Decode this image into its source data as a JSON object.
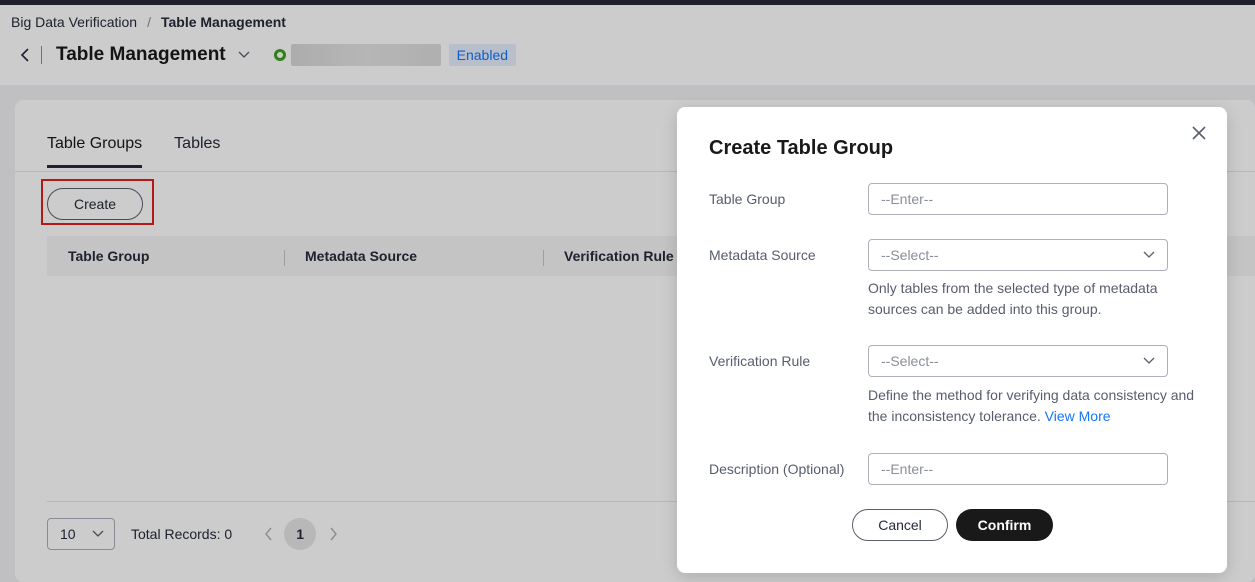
{
  "breadcrumb": {
    "parent": "Big Data Verification",
    "separator": "/",
    "current": "Table Management"
  },
  "header": {
    "title": "Table Management",
    "status": "Enabled"
  },
  "tabs": [
    {
      "label": "Table Groups",
      "active": true
    },
    {
      "label": "Tables",
      "active": false
    }
  ],
  "toolbar": {
    "create_label": "Create"
  },
  "table": {
    "columns": [
      "Table Group",
      "Metadata Source",
      "Verification Rule"
    ]
  },
  "pagination": {
    "page_size": "10",
    "total": "Total Records: 0",
    "current_page": "1"
  },
  "modal": {
    "title": "Create Table Group",
    "fields": {
      "table_group": {
        "label": "Table Group",
        "placeholder": "--Enter--"
      },
      "metadata_source": {
        "label": "Metadata Source",
        "placeholder": "--Select--",
        "help_line1": "Only tables from the selected type of metadata",
        "help_line2": "sources can be added into this group."
      },
      "verification_rule": {
        "label": "Verification Rule",
        "placeholder": "--Select--",
        "help_line1": "Define the method for verifying data consistency and",
        "help_line2": "the inconsistency tolerance.",
        "help_link": "View More"
      },
      "description": {
        "label": "Description (Optional)",
        "placeholder": "--Enter--"
      }
    },
    "cancel_label": "Cancel",
    "confirm_label": "Confirm"
  },
  "colors": {
    "status_dot": "#3fa11c",
    "badge_text": "#1476ff",
    "highlight": "#e02020",
    "primary_button": "#191919",
    "link": "#1476ff"
  },
  "icons": {
    "back": "chevron-left-icon",
    "title_dropdown": "chevron-down-icon",
    "close": "close-icon",
    "select": "chevron-down-icon"
  }
}
